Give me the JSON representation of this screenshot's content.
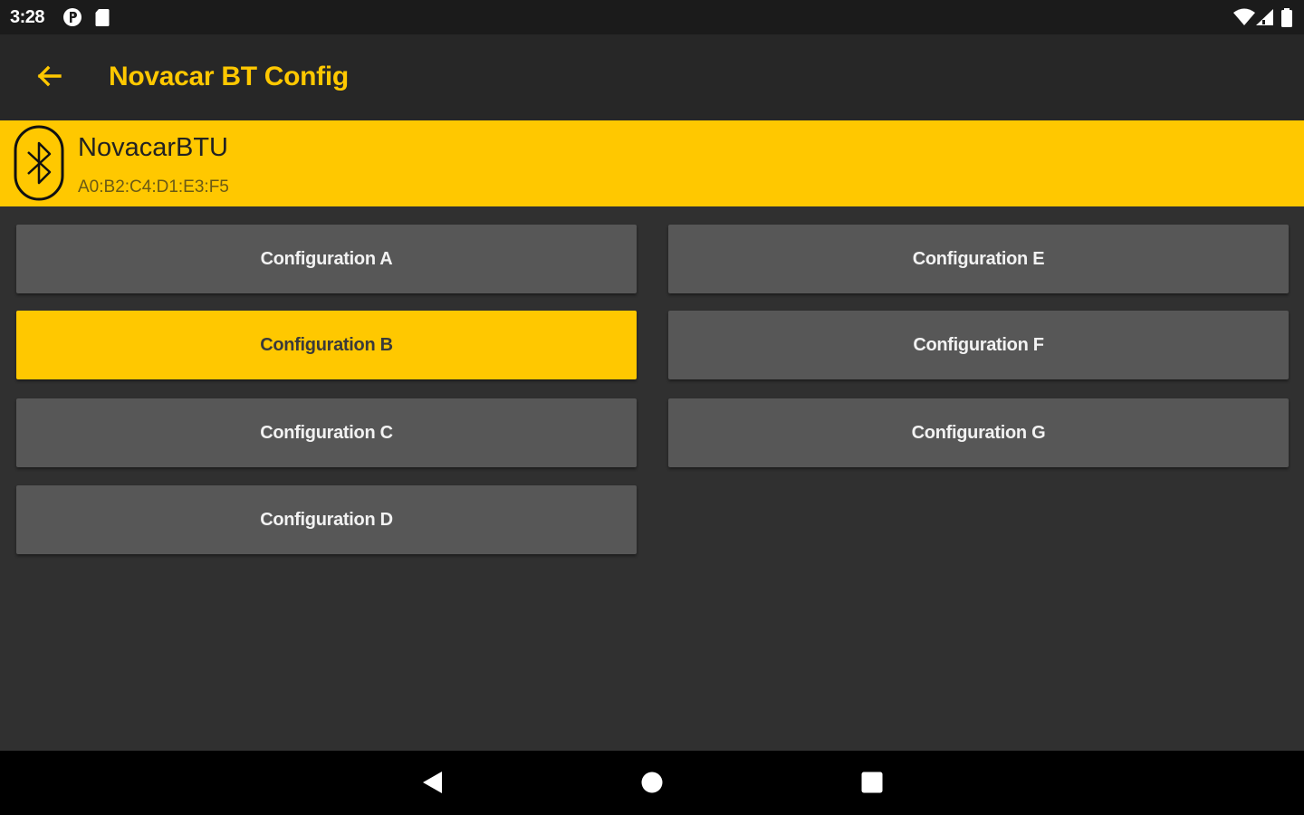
{
  "status_bar": {
    "time": "3:28",
    "left_icons": [
      "p-circle-icon",
      "sd-card-icon"
    ],
    "right_icons": [
      "wifi-icon",
      "signal-icon",
      "battery-icon"
    ]
  },
  "app_bar": {
    "back_icon": "arrow-left-icon",
    "title": "Novacar BT Config"
  },
  "device": {
    "icon": "bluetooth-icon",
    "name": "NovacarBTU",
    "address": "A0:B2:C4:D1:E3:F5"
  },
  "configurations": [
    {
      "label": "Configuration A",
      "selected": false
    },
    {
      "label": "Configuration B",
      "selected": true
    },
    {
      "label": "Configuration C",
      "selected": false
    },
    {
      "label": "Configuration D",
      "selected": false
    },
    {
      "label": "Configuration E",
      "selected": false
    },
    {
      "label": "Configuration F",
      "selected": false
    },
    {
      "label": "Configuration G",
      "selected": false
    }
  ],
  "nav_bar": {
    "icons": [
      "back-triangle-icon",
      "home-circle-icon",
      "recents-square-icon"
    ]
  },
  "colors": {
    "accent": "#ffc800",
    "background": "#303030",
    "app_bar": "#272727",
    "button": "#575757"
  }
}
